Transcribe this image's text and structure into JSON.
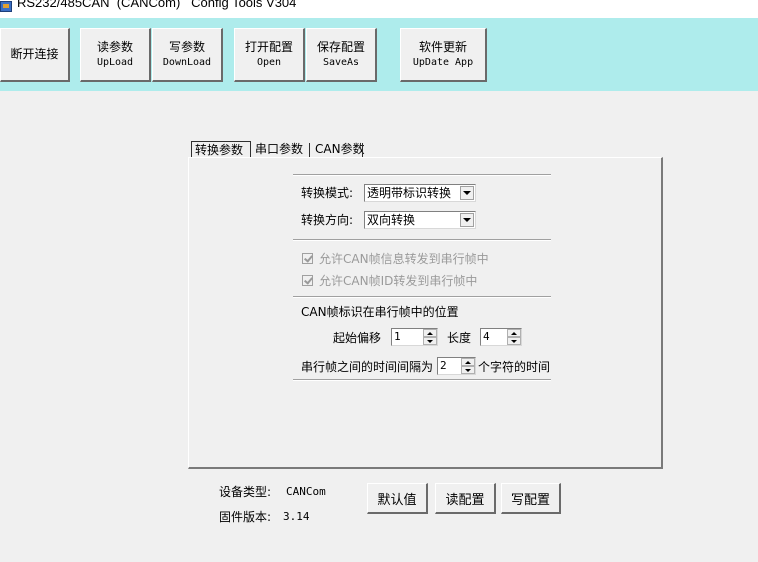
{
  "window": {
    "title": "RS232/485CAN  (CANCom)   Config Tools V304"
  },
  "toolbar": {
    "disconnect": "断开连接",
    "upload": {
      "label": "读参数",
      "sub": "UpLoad"
    },
    "download": {
      "label": "写参数",
      "sub": "DownLoad"
    },
    "open": {
      "label": "打开配置",
      "sub": "Open"
    },
    "saveas": {
      "label": "保存配置",
      "sub": "SaveAs"
    },
    "update": {
      "label": "软件更新",
      "sub": "UpDate App"
    }
  },
  "tabs": [
    "转换参数",
    "串口参数",
    "CAN参数"
  ],
  "form": {
    "mode_label": "转换模式:",
    "mode_value": "透明带标识转换",
    "direction_label": "转换方向:",
    "direction_value": "双向转换",
    "check1": "允许CAN帧信息转发到串行帧中",
    "check2": "允许CAN帧ID转发到串行帧中",
    "position_title": "CAN帧标识在串行帧中的位置",
    "offset_label": "起始偏移",
    "offset_value": "1",
    "length_label": "长度",
    "length_value": "4",
    "interval_label": "串行帧之间的时间间隔为",
    "interval_value": "2",
    "interval_suffix": "个字符的时间"
  },
  "device": {
    "type_label": "设备类型:",
    "type_value": "CANCom",
    "fw_label": "固件版本:",
    "fw_value": "3.14"
  },
  "buttons": {
    "default": "默认值",
    "read": "读配置",
    "write": "写配置"
  },
  "colors": {
    "toolbar_bg": "#aeecec",
    "window_bg": "#f0f0f0"
  }
}
